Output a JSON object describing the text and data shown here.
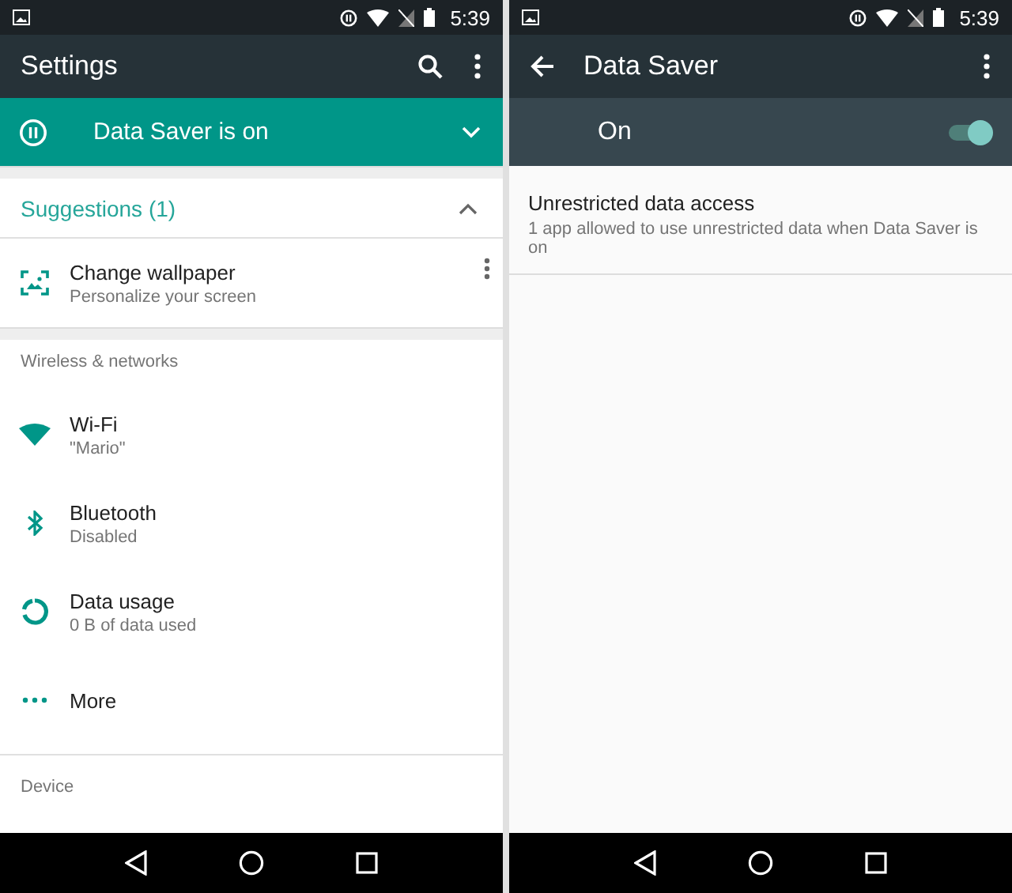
{
  "screens": [
    {
      "status_bar": {
        "time": "5:39"
      },
      "toolbar": {
        "title": "Settings",
        "actions": [
          {
            "kind": "search"
          },
          {
            "kind": "overflow"
          }
        ]
      },
      "banner": {
        "label": "Data Saver is on",
        "expanded": false
      },
      "suggestions": {
        "title": "Suggestions (1)",
        "expanded": true,
        "items": [
          {
            "title": "Change wallpaper",
            "subtitle": "Personalize your screen"
          }
        ]
      },
      "sections": [
        {
          "header": "Wireless & networks",
          "items": [
            {
              "kind": "wifi",
              "title": "Wi-Fi",
              "subtitle": "\"Mario\""
            },
            {
              "kind": "bluetooth",
              "title": "Bluetooth",
              "subtitle": "Disabled"
            },
            {
              "kind": "data",
              "title": "Data usage",
              "subtitle": "0 B of data used"
            },
            {
              "kind": "more",
              "title": "More"
            }
          ]
        },
        {
          "header": "Device"
        }
      ]
    },
    {
      "status_bar": {
        "time": "5:39"
      },
      "toolbar": {
        "leading": {
          "kind": "back"
        },
        "title": "Data Saver",
        "actions": [
          {
            "kind": "overflow"
          }
        ]
      },
      "master_switch": {
        "label": "On",
        "on": true
      },
      "items": [
        {
          "title": "Unrestricted data access",
          "subtitle": "1 app allowed to use unrestricted data when Data Saver is on"
        }
      ]
    }
  ]
}
